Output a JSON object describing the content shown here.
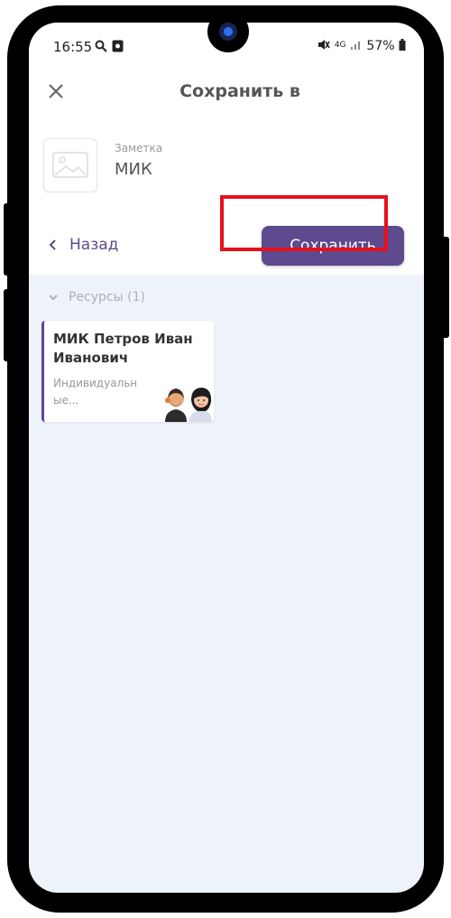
{
  "status_bar": {
    "time": "16:55",
    "network": "4G",
    "battery": "57%"
  },
  "header": {
    "title": "Сохранить в"
  },
  "note": {
    "label": "Заметка",
    "name": "МИК"
  },
  "actions": {
    "back_label": "Назад",
    "save_label": "Сохранить"
  },
  "resources": {
    "section_label": "Ресурсы (1)",
    "items": [
      {
        "title": "МИК Петров Иван Иванович",
        "subtitle": "Индивидуальн ые..."
      }
    ]
  },
  "colors": {
    "accent": "#5e4a8e",
    "highlight": "#e8101b",
    "background": "#eef2f9"
  }
}
